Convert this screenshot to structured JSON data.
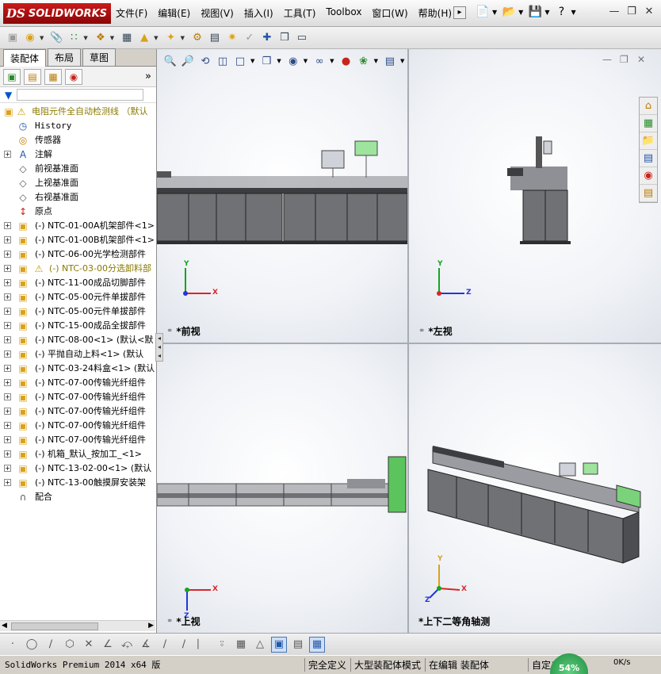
{
  "app": {
    "logo": "SOLIDWORKS",
    "logo_prefix": "DS"
  },
  "menu": [
    "文件(F)",
    "编辑(E)",
    "视图(V)",
    "插入(I)",
    "工具(T)",
    "Toolbox",
    "窗口(W)",
    "帮助(H)"
  ],
  "quick_access": [
    "new-document-icon",
    "open-folder-icon",
    "save-icon",
    "help-icon"
  ],
  "left_panel": {
    "tabs": [
      "装配体",
      "布局",
      "草图"
    ],
    "active_tab": "装配体",
    "filter_icon": "filter-icon",
    "tree": {
      "root": "电阻元件全自动检测线 （默认",
      "items": [
        {
          "label": "History",
          "icon": "history-icon",
          "mono": true
        },
        {
          "label": "传感器",
          "icon": "sensor-icon"
        },
        {
          "label": "注解",
          "icon": "annotation-icon",
          "expand": true
        },
        {
          "label": "前视基准面",
          "icon": "plane-icon"
        },
        {
          "label": "上视基准面",
          "icon": "plane-icon"
        },
        {
          "label": "右视基准面",
          "icon": "plane-icon"
        },
        {
          "label": "原点",
          "icon": "origin-icon"
        },
        {
          "label": "(-) NTC-01-00A机架部件<1>",
          "icon": "assembly-icon",
          "expand": true
        },
        {
          "label": "(-) NTC-01-00B机架部件<1>",
          "icon": "assembly-icon",
          "expand": true
        },
        {
          "label": "(-) NTC-06-00光学检测部件",
          "icon": "assembly-icon",
          "expand": true
        },
        {
          "label": "(-) NTC-03-00分选卸料部",
          "icon": "assembly-icon",
          "expand": true,
          "warning": true
        },
        {
          "label": "(-) NTC-11-00成品切脚部件",
          "icon": "assembly-icon",
          "expand": true
        },
        {
          "label": "(-) NTC-05-00元件单拔部件",
          "icon": "assembly-icon",
          "expand": true
        },
        {
          "label": "(-) NTC-05-00元件单拔部件",
          "icon": "assembly-icon",
          "expand": true
        },
        {
          "label": "(-) NTC-15-00成品全拔部件",
          "icon": "assembly-icon",
          "expand": true
        },
        {
          "label": "(-) NTC-08-00<1> (默认<默",
          "icon": "assembly-icon",
          "expand": true
        },
        {
          "label": "(-) 平抛自动上料<1> (默认",
          "icon": "assembly-icon",
          "expand": true
        },
        {
          "label": "(-) NTC-03-24料盒<1> (默认",
          "icon": "assembly-icon",
          "expand": true
        },
        {
          "label": "(-) NTC-07-00传输光纤组件",
          "icon": "assembly-icon",
          "expand": true
        },
        {
          "label": "(-) NTC-07-00传输光纤组件",
          "icon": "assembly-icon",
          "expand": true
        },
        {
          "label": "(-) NTC-07-00传输光纤组件",
          "icon": "assembly-icon",
          "expand": true
        },
        {
          "label": "(-) NTC-07-00传输光纤组件",
          "icon": "assembly-icon",
          "expand": true
        },
        {
          "label": "(-) NTC-07-00传输光纤组件",
          "icon": "assembly-icon",
          "expand": true
        },
        {
          "label": "(-) 机箱_默认_按加工_<1>",
          "icon": "assembly-icon",
          "expand": true
        },
        {
          "label": "(-) NTC-13-02-00<1> (默认",
          "icon": "assembly-icon",
          "expand": true
        },
        {
          "label": "(-) NTC-13-00触摸屏安装架",
          "icon": "assembly-icon",
          "expand": true
        },
        {
          "label": "配合",
          "icon": "mates-icon"
        }
      ]
    }
  },
  "viewports": [
    {
      "label": "*前视",
      "axes": [
        "Y",
        "X"
      ]
    },
    {
      "label": "*左视",
      "axes": [
        "Y",
        "Z"
      ]
    },
    {
      "label": "*上视",
      "axes": [
        "X",
        "Z"
      ]
    },
    {
      "label": "*上下二等角轴测",
      "axes": [
        "Y",
        "X",
        "Z"
      ]
    }
  ],
  "status": {
    "product": "SolidWorks Premium 2014 x64 版",
    "fully_defined": "完全定义",
    "large_assembly": "大型装配体模式",
    "editing": "在编辑 装配体",
    "custom": "自定义",
    "speed_percent": "54%",
    "net_speed": "0K/s"
  },
  "colors": {
    "logo_red": "#b00f0f",
    "machine_gray": "#6f7174",
    "machine_dark": "#3c3d40",
    "axis_x": "#d9262a",
    "axis_y": "#16a51e",
    "axis_z": "#2436d6"
  }
}
